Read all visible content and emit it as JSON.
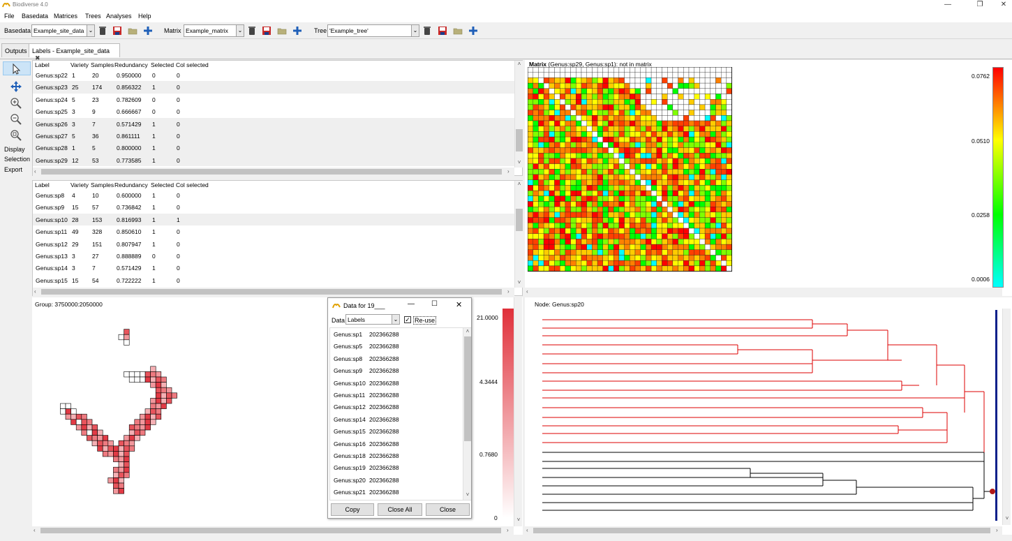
{
  "window": {
    "title": "Biodiverse 4.0",
    "controls": [
      "—",
      "❐",
      "✕"
    ]
  },
  "menu": [
    "File",
    "Basedata",
    "Matrices",
    "Trees",
    "Analyses",
    "Help"
  ],
  "toolbar": {
    "basedata_label": "Basedata",
    "basedata_value": "Example_site_data",
    "matrix_label": "Matrix",
    "matrix_value": "Example_matrix",
    "tree_label": "Tree",
    "tree_value": "'Example_tree'"
  },
  "tabs": [
    {
      "label": "Outputs"
    },
    {
      "label": "Labels - Example_site_data"
    }
  ],
  "side_tools": {
    "display_label": "Display",
    "selection_label": "Selection",
    "export_label": "Export"
  },
  "label_table_columns": [
    "Label",
    "Variety",
    "Samples",
    "Redundancy",
    "Selected",
    "Col selected"
  ],
  "upper_table_rows": [
    [
      "Genus:sp22",
      "1",
      "20",
      "0.950000",
      "0",
      "0"
    ],
    [
      "Genus:sp23",
      "25",
      "174",
      "0.856322",
      "1",
      "0"
    ],
    [
      "Genus:sp24",
      "5",
      "23",
      "0.782609",
      "0",
      "0"
    ],
    [
      "Genus:sp25",
      "3",
      "9",
      "0.666667",
      "0",
      "0"
    ],
    [
      "Genus:sp26",
      "3",
      "7",
      "0.571429",
      "1",
      "0"
    ],
    [
      "Genus:sp27",
      "5",
      "36",
      "0.861111",
      "1",
      "0"
    ],
    [
      "Genus:sp28",
      "1",
      "5",
      "0.800000",
      "1",
      "0"
    ],
    [
      "Genus:sp29",
      "12",
      "53",
      "0.773585",
      "1",
      "0"
    ]
  ],
  "lower_table_rows": [
    [
      "Genus:sp8",
      "4",
      "10",
      "0.600000",
      "1",
      "0"
    ],
    [
      "Genus:sp9",
      "15",
      "57",
      "0.736842",
      "1",
      "0"
    ],
    [
      "Genus:sp10",
      "28",
      "153",
      "0.816993",
      "1",
      "1"
    ],
    [
      "Genus:sp11",
      "49",
      "328",
      "0.850610",
      "1",
      "0"
    ],
    [
      "Genus:sp12",
      "29",
      "151",
      "0.807947",
      "1",
      "0"
    ],
    [
      "Genus:sp13",
      "3",
      "27",
      "0.888889",
      "0",
      "0"
    ],
    [
      "Genus:sp14",
      "3",
      "7",
      "0.571429",
      "1",
      "0"
    ],
    [
      "Genus:sp15",
      "15",
      "54",
      "0.722222",
      "1",
      "0"
    ]
  ],
  "matrix_panel": {
    "title_bold": "Matrix",
    "title_rest": " (Genus:sp29, Genus:sp1): not in matrix",
    "legend_values": [
      "0.0762",
      "0.0510",
      "0.0258",
      "0.0006"
    ],
    "legend_colors": [
      "#ff0000",
      "#ffff00",
      "#00ff00",
      "#00ffff"
    ]
  },
  "map_panel": {
    "group_label": "Group: 3750000:2050000",
    "legend_values": [
      "21.0000",
      "4.3444",
      "0.7680",
      "0"
    ],
    "cell_color": "#e8545c"
  },
  "tree_panel": {
    "node_label": "Node: Genus:sp20",
    "highlight_color": "#dd0000",
    "marker_color": "#b01818",
    "bar_color": "#0a1f8a"
  },
  "dialog": {
    "title": "Data for 19___",
    "data_label": "Data",
    "data_select_value": "Labels",
    "reuse_label": "Re-use",
    "reuse_checked": true,
    "rows": [
      [
        "Genus:sp1",
        "202366288"
      ],
      [
        "Genus:sp5",
        "202366288"
      ],
      [
        "Genus:sp8",
        "202366288"
      ],
      [
        "Genus:sp9",
        "202366288"
      ],
      [
        "Genus:sp10",
        "202366288"
      ],
      [
        "Genus:sp11",
        "202366288"
      ],
      [
        "Genus:sp12",
        "202366288"
      ],
      [
        "Genus:sp14",
        "202366288"
      ],
      [
        "Genus:sp15",
        "202366288"
      ],
      [
        "Genus:sp16",
        "202366288"
      ],
      [
        "Genus:sp18",
        "202366288"
      ],
      [
        "Genus:sp19",
        "202366288"
      ],
      [
        "Genus:sp20",
        "202366288"
      ],
      [
        "Genus:sp21",
        "202366288"
      ]
    ],
    "buttons": {
      "copy": "Copy",
      "close_all": "Close All",
      "close": "Close"
    }
  }
}
